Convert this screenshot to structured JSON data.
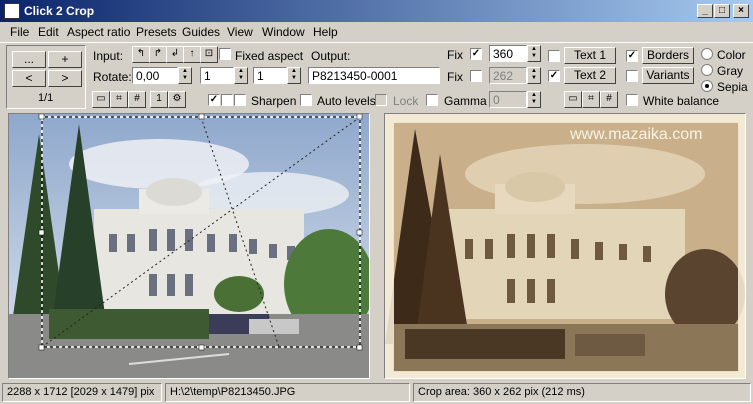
{
  "window": {
    "title": "Click 2 Crop",
    "min": "_",
    "max": "□",
    "close": "×"
  },
  "menu": [
    "File",
    "Edit",
    "Aspect ratio",
    "Presets",
    "Guides",
    "View",
    "Window",
    "Help"
  ],
  "nav": {
    "prev_more": "...",
    "add": "+",
    "prev": "<",
    "next": ">",
    "counter": "1/1"
  },
  "input": {
    "label": "Input:",
    "rotate_label": "Rotate:",
    "rotate_value": "0,00",
    "fixed_aspect_label": "Fixed aspect",
    "aspect_w": "1",
    "aspect_h": "1"
  },
  "output": {
    "label": "Output:",
    "filename": "P8213450-0001",
    "fix_label": "Fix",
    "width": "360",
    "height": "262",
    "fix_width_checked": true,
    "fix_height_checked": false
  },
  "text_buttons": {
    "text1": "Text 1",
    "text2": "Text 2",
    "text1_checked": false,
    "text2_checked": true
  },
  "effects": {
    "borders": "Borders",
    "variants": "Variants",
    "borders_checked": true,
    "variants_checked": false,
    "color": "Color",
    "gray": "Gray",
    "sepia": "Sepia",
    "selected_mode": "Sepia",
    "white_balance": "White balance"
  },
  "adjust": {
    "sharpen": "Sharpen",
    "auto_levels": "Auto levels",
    "lock": "Lock",
    "gamma": "Gamma",
    "gamma_value": "0"
  },
  "watermark": "www.mazaika.com",
  "status": {
    "dimensions": "2288 x 1712  [2029 x 1479] pix",
    "path": "H:\\2\\temp\\P8213450.JPG",
    "crop": "Crop area: 360 x 262 pix (212 ms)"
  }
}
